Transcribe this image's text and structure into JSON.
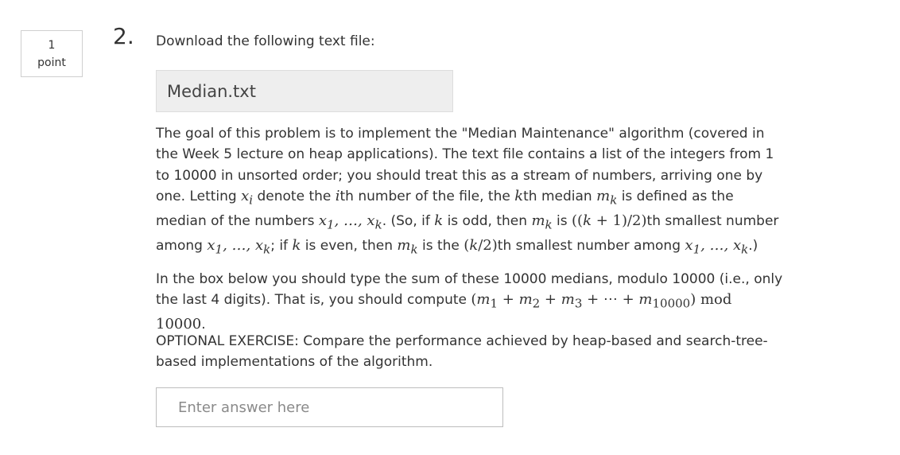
{
  "question": {
    "points_value": "1",
    "points_label": "point",
    "number": "2.",
    "intro": "Download the following text file:",
    "file_name": "Median.txt",
    "paragraph1": {
      "s1": "The goal of this problem is to implement the \"Median Maintenance\" algorithm (covered in the Week 5 lecture on heap applications). The text file contains a list of the integers from 1 to 10000 in unsorted order; you should treat this as a stream of numbers, arriving one by one. Letting",
      "s2": "denote the",
      "s3": "th number of the file, the",
      "s4": "th median",
      "s5": "is defined as the median of the numbers",
      "s6": ". (So, if",
      "s7": "is odd, then",
      "s8": "is",
      "s9": "th smallest number among",
      "s10": "; if",
      "s11": "is even, then",
      "s12": "is the",
      "s13": "th smallest number among",
      "s14": ".)"
    },
    "paragraph2": {
      "s1": "In the box below you should type the sum of these 10000 medians, modulo 10000 (i.e., only the last 4 digits). That is, you should compute",
      "s2": "."
    },
    "paragraph3": "OPTIONAL EXERCISE: Compare the performance achieved by heap-based and search-tree-based implementations of the algorithm.",
    "answer_placeholder": "Enter answer here",
    "answer_value": ""
  }
}
